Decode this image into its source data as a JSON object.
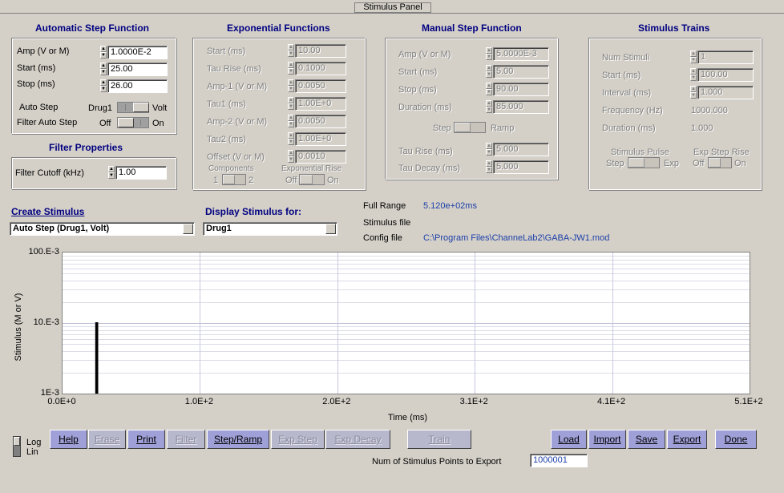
{
  "window": {
    "title": "Stimulus Panel"
  },
  "auto_step": {
    "title": "Automatic Step Function",
    "amp_label": "Amp (V or M)",
    "amp_value": "1.0000E-2",
    "start_label": "Start (ms)",
    "start_value": "25.00",
    "stop_label": "Stop (ms)",
    "stop_value": "26.00",
    "auto_step_label": "Auto Step",
    "auto_step_left": "Drug1",
    "auto_step_right": "Volt",
    "filter_auto_label": "Filter Auto Step",
    "filter_auto_left": "Off",
    "filter_auto_right": "On"
  },
  "filter": {
    "title": "Filter Properties",
    "cutoff_label": "Filter Cutoff (kHz)",
    "cutoff_value": "1.00"
  },
  "exponential": {
    "title": "Exponential Functions",
    "fields": [
      {
        "label": "Start (ms)",
        "value": "10.00"
      },
      {
        "label": "Tau Rise (ms)",
        "value": "0.1000"
      },
      {
        "label": "Amp-1 (V or M)",
        "value": "0.0050"
      },
      {
        "label": "Tau1 (ms)",
        "value": "1.00E+0"
      },
      {
        "label": "Amp-2 (V or M)",
        "value": "0.0050"
      },
      {
        "label": "Tau2 (ms)",
        "value": "1.00E+0"
      },
      {
        "label": "Offset (V or M)",
        "value": "0.0010"
      }
    ],
    "components_label": "Components",
    "components_left": "1",
    "components_right": "2",
    "exp_rise_label": "Exponential Rise",
    "exp_rise_left": "Off",
    "exp_rise_right": "On"
  },
  "manual_step": {
    "title": "Manual Step Function",
    "fields": [
      {
        "label": "Amp (V or M)",
        "value": "5.0000E-3"
      },
      {
        "label": "Start (ms)",
        "value": "5.00"
      },
      {
        "label": "Stop (ms)",
        "value": "90.00"
      },
      {
        "label": "Duration (ms)",
        "value": "85.000"
      }
    ],
    "step_label": "Step",
    "ramp_label": "Ramp",
    "tau_rise_label": "Tau Rise (ms)",
    "tau_rise_value": "5.000",
    "tau_decay_label": "Tau Decay (ms)",
    "tau_decay_value": "5.000"
  },
  "trains": {
    "title": "Stimulus Trains",
    "fields": [
      {
        "label": "Num Stimuli",
        "value": "1"
      },
      {
        "label": "Start (ms)",
        "value": "100.00"
      },
      {
        "label": "Interval (ms)",
        "value": "1.000"
      }
    ],
    "frequency_label": "Frequency (Hz)",
    "frequency_value": "1000.000",
    "duration_label": "Duration (ms)",
    "duration_value": "1.000",
    "pulse_label": "Stimulus Pulse",
    "pulse_left": "Step",
    "pulse_right": "Exp",
    "exp_step_label": "Exp Step Rise",
    "exp_step_left": "Off",
    "exp_step_right": "On"
  },
  "create": {
    "label": "Create Stimulus",
    "value": "Auto Step (Drug1, Volt)"
  },
  "display": {
    "label": "Display Stimulus for:",
    "value": "Drug1"
  },
  "info": {
    "full_range_label": "Full Range",
    "full_range_value": "5.120e+02ms",
    "stim_file_label": "Stimulus file",
    "config_label": "Config file",
    "config_value": "C:\\Program Files\\ChanneLab2\\GABA-JW1.mod"
  },
  "chart_data": {
    "type": "line",
    "ylabel": "Stimulus (M or V)",
    "xlabel": "Time (ms)",
    "x_ticks": [
      "0.0E+0",
      "1.0E+2",
      "2.0E+2",
      "3.1E+2",
      "4.1E+2",
      "5.1E+2"
    ],
    "y_ticks": [
      "100.E-3",
      "10.E-3",
      "1E-3"
    ],
    "xlim": [
      0,
      512
    ],
    "ylim": [
      0.001,
      0.1
    ],
    "y_scale": "log",
    "grid": true,
    "series": [
      {
        "color": "#000000",
        "x": [
          25,
          25,
          26,
          26
        ],
        "y": [
          0.001,
          0.01,
          0.01,
          0.001
        ]
      }
    ]
  },
  "scale_toggle": {
    "top": "Log",
    "bottom": "Lin"
  },
  "buttons": {
    "help": "Help",
    "erase": "Erase",
    "print": "Print",
    "filter": "Filter",
    "step_ramp": "Step/Ramp",
    "exp_step": "Exp Step",
    "exp_decay": "Exp Decay",
    "train": "Train",
    "load": "Load",
    "import": "Import",
    "save": "Save",
    "export": "Export",
    "done": "Done"
  },
  "export_points": {
    "label": "Num of Stimulus Points to Export",
    "value": "1000001"
  },
  "colors": {
    "accent": "#000080",
    "button": "#a0a0d8",
    "value_blue": "#1c3fa8"
  }
}
